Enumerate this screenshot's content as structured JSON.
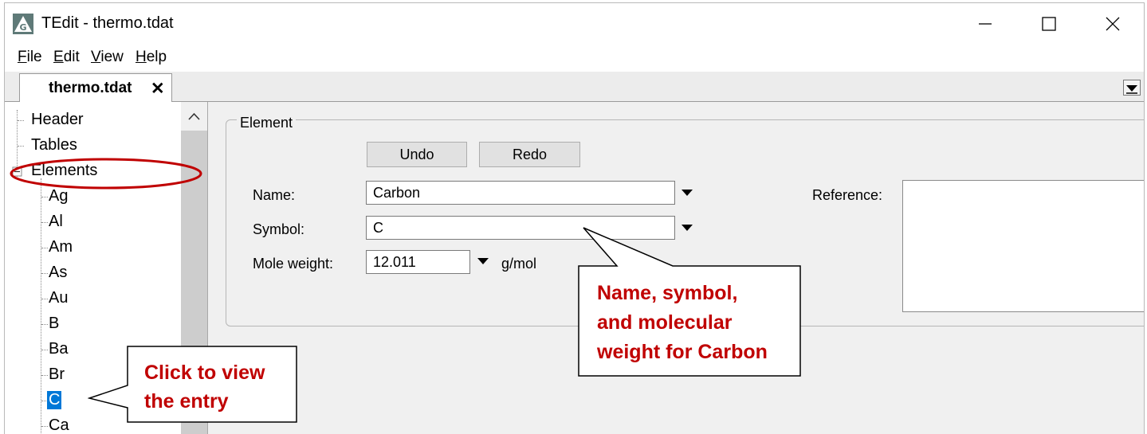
{
  "window": {
    "title": "TEdit - thermo.tdat"
  },
  "menu": [
    {
      "accel": "F",
      "rest": "ile"
    },
    {
      "accel": "E",
      "rest": "dit"
    },
    {
      "accel": "V",
      "rest": "iew"
    },
    {
      "accel": "H",
      "rest": "elp"
    }
  ],
  "tab": {
    "label": "thermo.tdat"
  },
  "tree": {
    "header": "Header",
    "tables": "Tables",
    "elements": "Elements",
    "children": [
      "Ag",
      "Al",
      "Am",
      "As",
      "Au",
      "B",
      "Ba",
      "Br",
      "C",
      "Ca"
    ],
    "selected": "C"
  },
  "element_panel": {
    "legend": "Element",
    "undo_label": "Undo",
    "redo_label": "Redo",
    "name_label": "Name:",
    "name_value": "Carbon",
    "symbol_label": "Symbol:",
    "symbol_value": "C",
    "mole_weight_label": "Mole weight:",
    "mole_weight_value": "12.011",
    "mole_weight_unit": "g/mol",
    "reference_label": "Reference:"
  },
  "callouts": {
    "click_entry": [
      "Click to view",
      "the entry"
    ],
    "name_symbol": [
      "Name, symbol,",
      "and molecular",
      "weight for Carbon"
    ]
  },
  "colors": {
    "callout_text": "#c00000",
    "highlight_ellipse": "#c00000",
    "selection": "#0078d7"
  }
}
